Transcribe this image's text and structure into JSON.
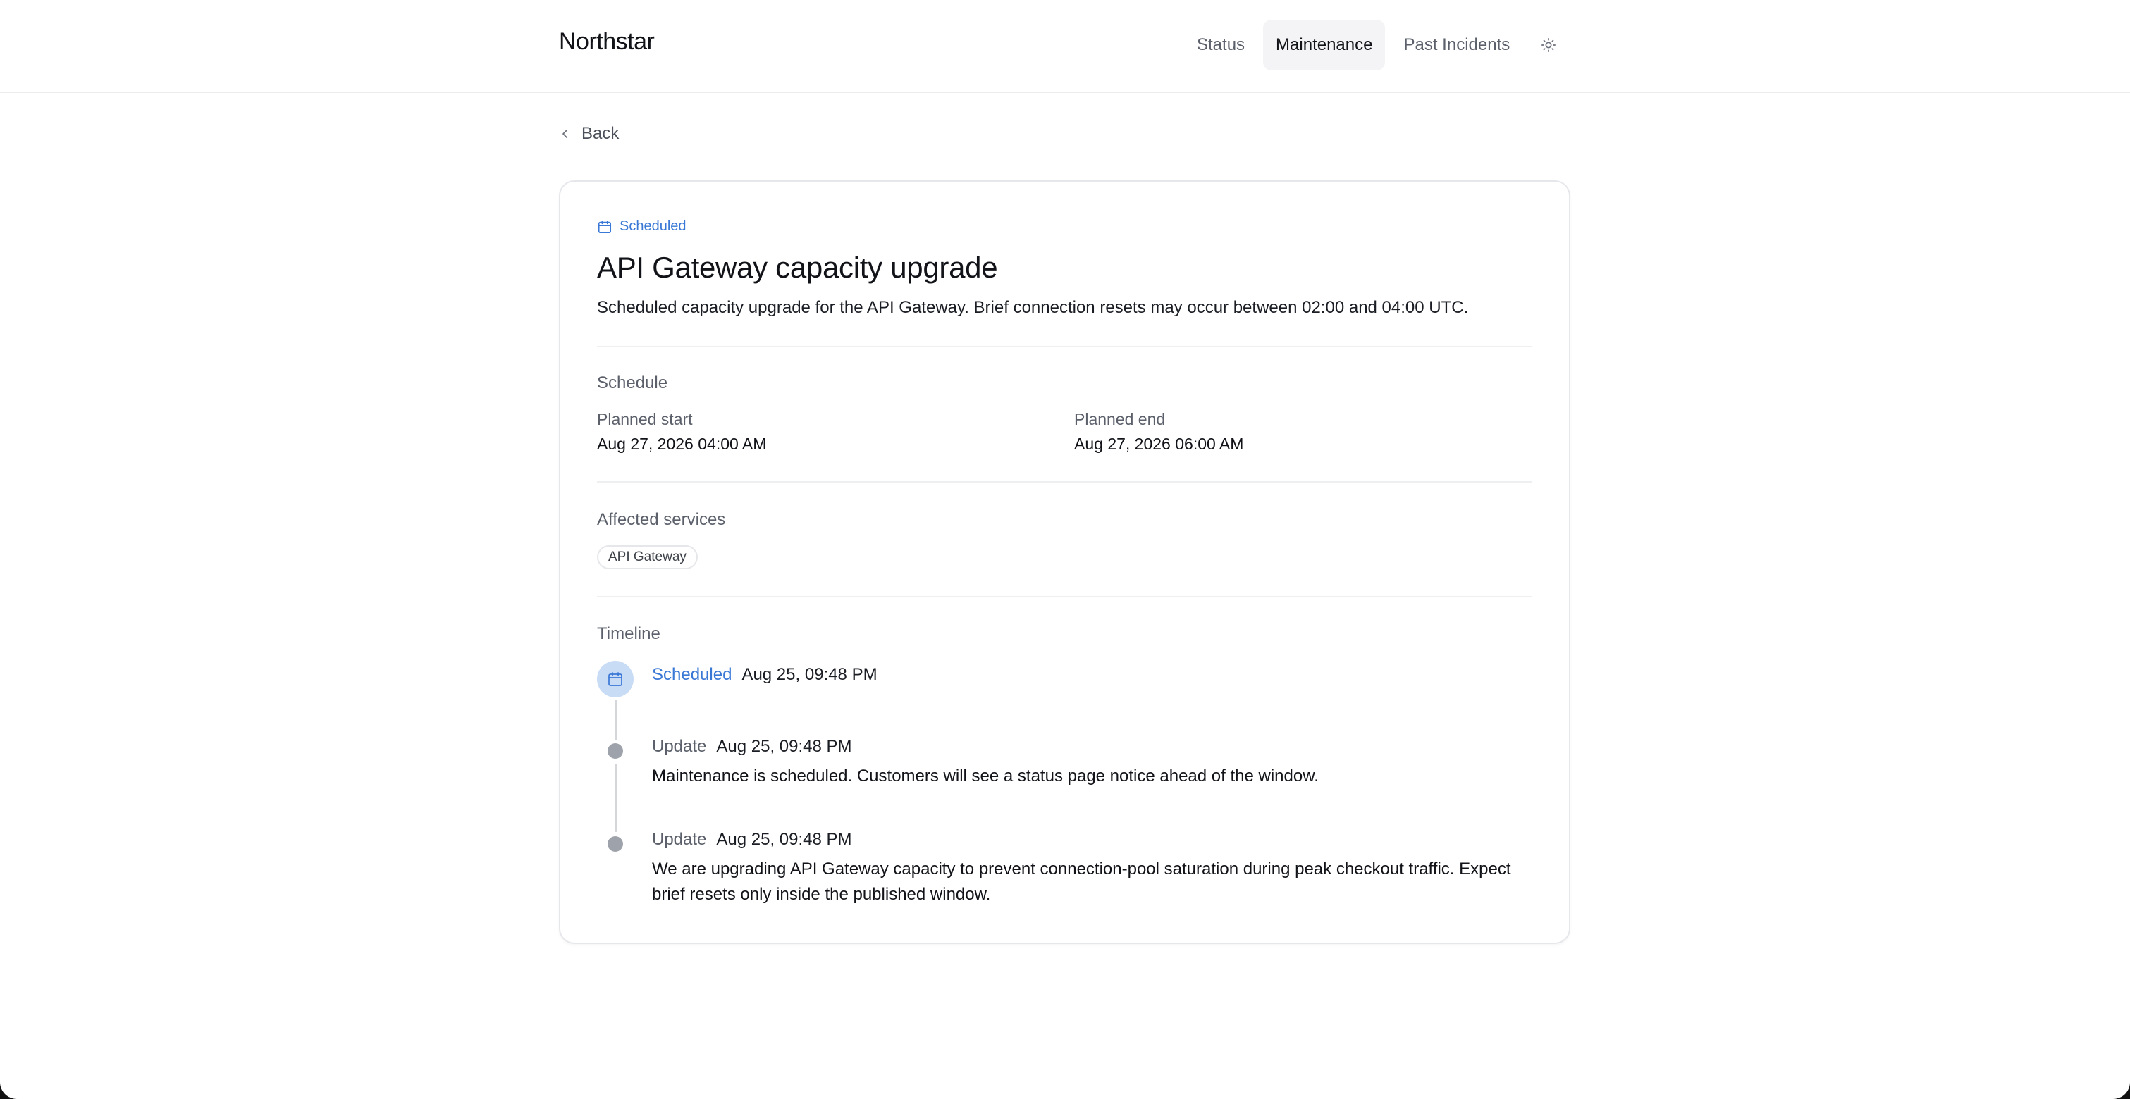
{
  "header": {
    "brand": "Northstar",
    "nav": [
      {
        "label": "Status",
        "active": false
      },
      {
        "label": "Maintenance",
        "active": true
      },
      {
        "label": "Past Incidents",
        "active": false
      }
    ],
    "theme_icon": "sun-icon"
  },
  "back": {
    "label": "Back",
    "icon": "chevron-left-icon"
  },
  "maintenance": {
    "status": "Scheduled",
    "status_icon": "calendar-icon",
    "title": "API Gateway capacity upgrade",
    "description": "Scheduled capacity upgrade for the API Gateway. Brief connection resets may occur between 02:00 and 04:00 UTC.",
    "schedule": {
      "label": "Schedule",
      "start_label": "Planned start",
      "start_value": "Aug 27, 2026 04:00 AM",
      "end_label": "Planned end",
      "end_value": "Aug 27, 2026 06:00 AM"
    },
    "affected": {
      "label": "Affected services",
      "services": [
        "API Gateway"
      ]
    },
    "timeline": {
      "label": "Timeline",
      "events": [
        {
          "type": "Scheduled",
          "time": "Aug 25, 09:48 PM",
          "body": ""
        },
        {
          "type": "Update",
          "time": "Aug 25, 09:48 PM",
          "body": "Maintenance is scheduled. Customers will see a status page notice ahead of the window."
        },
        {
          "type": "Update",
          "time": "Aug 25, 09:48 PM",
          "body_line1": "We are upgrading API Gateway capacity to prevent connection-pool saturation during peak checkout traffic. Expect",
          "body_line2": "brief resets only inside the published window."
        }
      ]
    }
  },
  "colors": {
    "accent": "#3a78d6",
    "border": "#e6e7ea",
    "muted_text": "#5b606b"
  }
}
